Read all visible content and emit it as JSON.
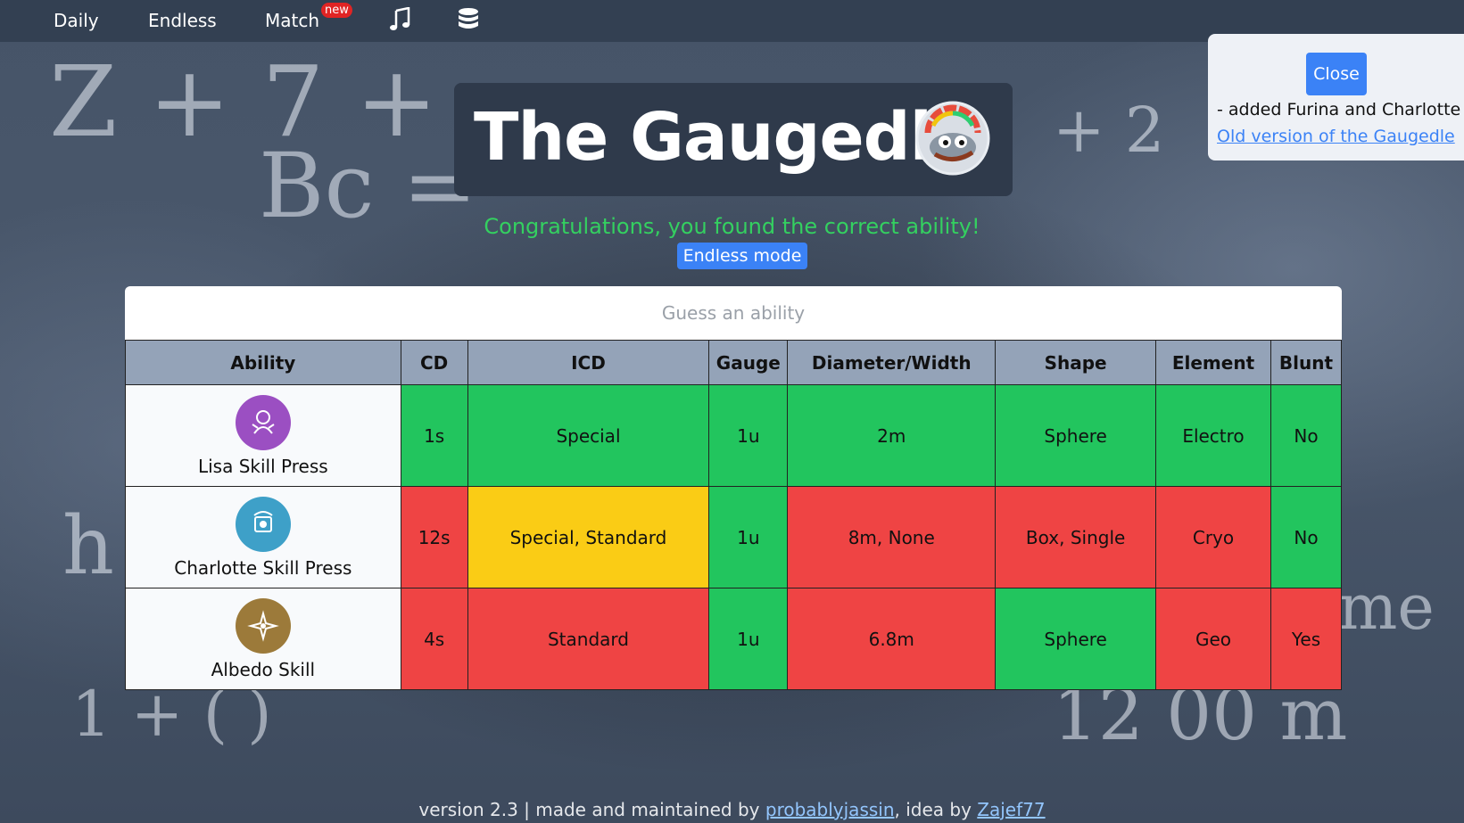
{
  "nav": {
    "daily": "Daily",
    "endless": "Endless",
    "match": "Match",
    "new_badge": "new",
    "music_icon": "music-note-icon",
    "database_icon": "database-icon"
  },
  "header": {
    "title": "The Gaugedle",
    "logo_icon": "gauge-frog-logo"
  },
  "status": {
    "congrats": "Congratulations, you found the correct ability!",
    "endless_button": "Endless mode"
  },
  "search": {
    "placeholder": "Guess an ability"
  },
  "table": {
    "headers": [
      "Ability",
      "CD",
      "ICD",
      "Gauge",
      "Diameter/Width",
      "Shape",
      "Element",
      "Blunt"
    ],
    "rows": [
      {
        "ability": "Lisa Skill Press",
        "icon": "lisa-skill-icon",
        "icon_color": "#9b4fc2",
        "cd": "1s",
        "icd": "Special",
        "gauge": "1u",
        "diameter": "2m",
        "shape": "Sphere",
        "element": "Electro",
        "blunt": "No",
        "status": [
          "green",
          "green",
          "green",
          "green",
          "green",
          "green",
          "green"
        ]
      },
      {
        "ability": "Charlotte Skill Press",
        "icon": "charlotte-skill-icon",
        "icon_color": "#3ea0c8",
        "cd": "12s",
        "icd": "Special, Standard",
        "gauge": "1u",
        "diameter": "8m, None",
        "shape": "Box, Single",
        "element": "Cryo",
        "blunt": "No",
        "status": [
          "red",
          "yellow",
          "green",
          "red",
          "red",
          "red",
          "green"
        ]
      },
      {
        "ability": "Albedo Skill",
        "icon": "albedo-skill-icon",
        "icon_color": "#9c7a3a",
        "cd": "4s",
        "icd": "Standard",
        "gauge": "1u",
        "diameter": "6.8m",
        "shape": "Sphere",
        "element": "Geo",
        "blunt": "Yes",
        "status": [
          "red",
          "red",
          "green",
          "red",
          "green",
          "red",
          "red"
        ]
      }
    ]
  },
  "notice": {
    "close_label": "Close",
    "message": "- added Furina and Charlotte",
    "old_version_link": "Old version of the Gaugedle"
  },
  "footer": {
    "prefix": "version 2.3 | made and maintained by ",
    "author": "probablyjassin",
    "middle": ", idea by ",
    "idea_by": "Zajef77"
  }
}
